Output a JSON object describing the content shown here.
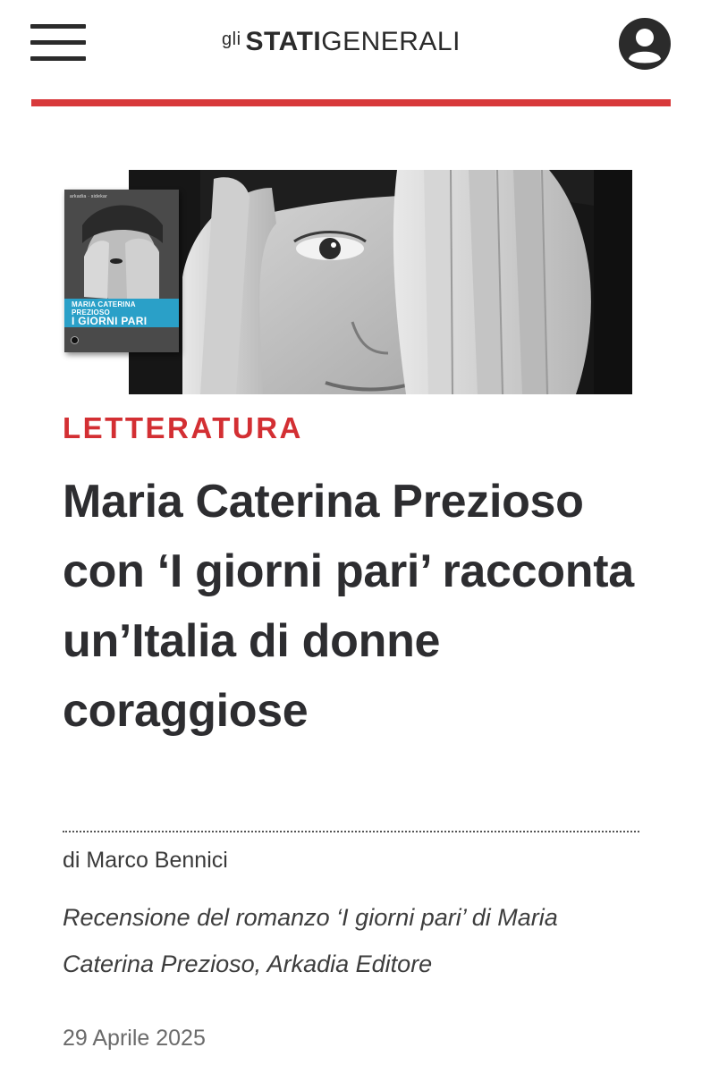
{
  "header": {
    "menu_icon": "hamburger-menu-icon",
    "logo": {
      "prefix": "gli",
      "bold": "STATI",
      "regular": "GENERALI"
    },
    "user_icon": "user-account-icon",
    "accent_color": "#d8393b"
  },
  "hero": {
    "book_cover": {
      "publisher_line": "arkadia · sidekar",
      "author": "MARIA CATERINA PREZIOSO",
      "title": "I GIORNI PARI",
      "band_color": "#2aa0c8"
    }
  },
  "article": {
    "category": "LETTERATURA",
    "title": "Maria Caterina Prezioso con ‘I giorni pari’ racconta un’Italia di donne coraggiose",
    "author": "di Marco Bennici",
    "subtitle": "Recensione del romanzo ‘I giorni pari’ di Maria Caterina Prezioso, Arkadia Editore",
    "date": "29 Aprile 2025",
    "category_color": "#d32f33"
  }
}
